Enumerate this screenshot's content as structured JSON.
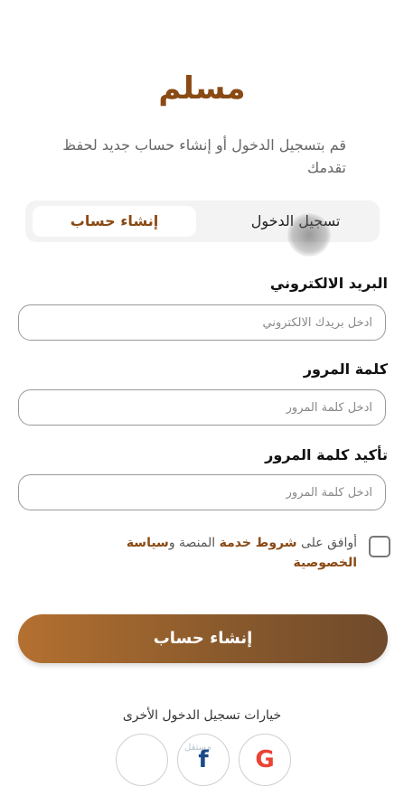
{
  "app": {
    "logo_text": "مسلم",
    "subtitle": "قم بتسجيل الدخول أو إنشاء حساب جديد لحفظ تقدمك"
  },
  "tabs": {
    "login": "تسجيل الدخول",
    "signup": "إنشاء حساب"
  },
  "form": {
    "email_label": "البريد الالكتروني",
    "email_placeholder": "ادخل بريدك الالكتروني",
    "password_label": "كلمة المرور",
    "password_placeholder": "ادخل كلمة المرور",
    "confirm_label": "تأكيد كلمة المرور",
    "confirm_placeholder": "ادخل كلمة المرور"
  },
  "agreement": {
    "prefix": "أوافق على ",
    "terms": "شروط خدمة",
    "middle": " المنصة و",
    "privacy": "سياسة الخصوصية"
  },
  "cta_label": "إنشاء حساب",
  "other_options": "خيارات تسجيل الدخول الأخرى",
  "social": {
    "apple_icon": "",
    "facebook_icon": "f",
    "google_icon": "G"
  },
  "watermark": "مستقل",
  "colors": {
    "brand": "#8a4a14",
    "button_start": "#b47030",
    "button_end": "#6f4a2c"
  }
}
